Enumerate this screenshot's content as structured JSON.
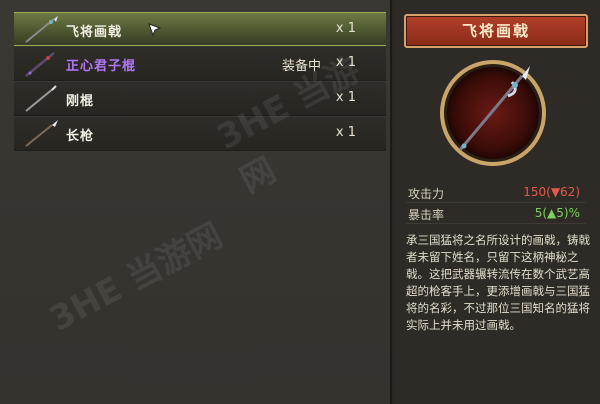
{
  "inventory": {
    "items": [
      {
        "name": "飞将画戟",
        "count": "x 1",
        "equipped": "",
        "selected": true,
        "color": "#f0ece0"
      },
      {
        "name": "正心君子棍",
        "count": "x 1",
        "equipped": "装备中",
        "selected": false,
        "color": "#b276f5"
      },
      {
        "name": "刚棍",
        "count": "x 1",
        "equipped": "",
        "selected": false,
        "color": "#f0ece0"
      },
      {
        "name": "长枪",
        "count": "x 1",
        "equipped": "",
        "selected": false,
        "color": "#f0ece0"
      }
    ]
  },
  "detail": {
    "title": "飞将画戟",
    "stats": [
      {
        "label": "攻击力",
        "value": "150(▼62)"
      },
      {
        "label": "暴击率",
        "value": "5(▲5)%"
      }
    ],
    "description": "承三国猛将之名所设计的画戟，铸戟者未留下姓名，只留下这柄神秘之戟。这把武器辗转流传在数个武艺高超的枪客手上，更添增画戟与三国猛将的名彩，不过那位三国知名的猛将实际上并未用过画戟。"
  },
  "watermark": "3HE 当游网",
  "colors": {
    "selected_row": "#6e7a44",
    "banner": "#b2402a",
    "atk": "#e45a4c",
    "crit": "#79d05a",
    "purple": "#b276f5"
  }
}
